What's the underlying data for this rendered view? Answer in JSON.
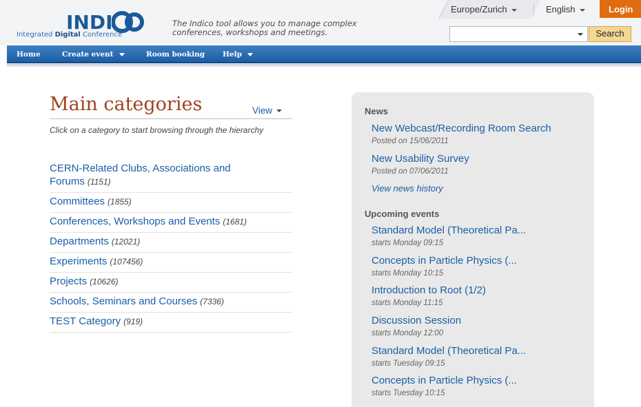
{
  "header": {
    "logo_word": "INDI",
    "logo_sub_prefix": "Integrated",
    "logo_sub_bold": "Digital",
    "logo_sub_suffix": "Conference",
    "tagline": "The Indico tool allows you to manage complex conferences, workshops and meetings.",
    "timezone": "Europe/Zurich",
    "language": "English",
    "login_label": "Login",
    "search_placeholder": "",
    "search_button": "Search"
  },
  "nav": {
    "home": "Home",
    "create_event": "Create event",
    "room_booking": "Room booking",
    "help": "Help"
  },
  "main": {
    "title": "Main categories",
    "view_label": "View",
    "hint": "Click on a category to start browsing through the hierarchy",
    "categories": [
      {
        "name": "CERN-Related Clubs, Associations and Forums",
        "count": "(1151)"
      },
      {
        "name": "Committees",
        "count": "(1855)"
      },
      {
        "name": "Conferences, Workshops and Events",
        "count": "(1681)"
      },
      {
        "name": "Departments",
        "count": "(12021)"
      },
      {
        "name": "Experiments",
        "count": "(107456)"
      },
      {
        "name": "Projects",
        "count": "(10626)"
      },
      {
        "name": "Schools, Seminars and Courses",
        "count": "(7336)"
      },
      {
        "name": "TEST Category",
        "count": "(919)"
      }
    ]
  },
  "side": {
    "news_heading": "News",
    "news": [
      {
        "title": "New Webcast/Recording Room Search",
        "date": "Posted on 15/06/2011"
      },
      {
        "title": "New Usability Survey",
        "date": "Posted on 07/06/2011"
      }
    ],
    "news_history": "View news history",
    "upcoming_heading": "Upcoming events",
    "events": [
      {
        "title": "Standard Model (Theoretical Pa...",
        "time": "starts Monday 09:15"
      },
      {
        "title": "Concepts in Particle Physics (...",
        "time": "starts Monday 10:15"
      },
      {
        "title": "Introduction to Root (1/2)",
        "time": "starts Monday 11:15"
      },
      {
        "title": "Discussion Session",
        "time": "starts Monday 12:00"
      },
      {
        "title": "Standard Model (Theoretical Pa...",
        "time": "starts Tuesday 09:15"
      },
      {
        "title": "Concepts in Particle Physics (...",
        "time": "starts Tuesday 10:15"
      }
    ]
  },
  "colors": {
    "accent_blue": "#1a5ea8",
    "title_brown": "#a0421d",
    "login_orange": "#e16c0f",
    "nav_blue": "#2a6db5"
  }
}
